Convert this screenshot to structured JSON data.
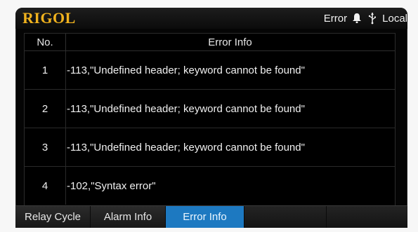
{
  "statusbar": {
    "brand": "RIGOL",
    "status_text": "Error",
    "bell_icon": "bell-icon",
    "usb_icon": "usb-icon",
    "mode_text": "Local"
  },
  "table": {
    "headers": [
      "No.",
      "Error Info"
    ],
    "rows": [
      {
        "no": "1",
        "message": "-113,\"Undefined header; keyword cannot be found\""
      },
      {
        "no": "2",
        "message": "-113,\"Undefined header; keyword cannot be found\""
      },
      {
        "no": "3",
        "message": "-113,\"Undefined header; keyword cannot be found\""
      },
      {
        "no": "4",
        "message": "-102,\"Syntax error\""
      }
    ]
  },
  "tabs": [
    {
      "label": "Relay Cycle",
      "active": false
    },
    {
      "label": "Alarm Info",
      "active": false
    },
    {
      "label": "Error Info",
      "active": true
    },
    {
      "label": "",
      "active": false
    },
    {
      "label": "",
      "active": false
    }
  ],
  "colors": {
    "brand": "#f0b21e",
    "active_tab": "#1d79c1",
    "background": "#050505"
  }
}
